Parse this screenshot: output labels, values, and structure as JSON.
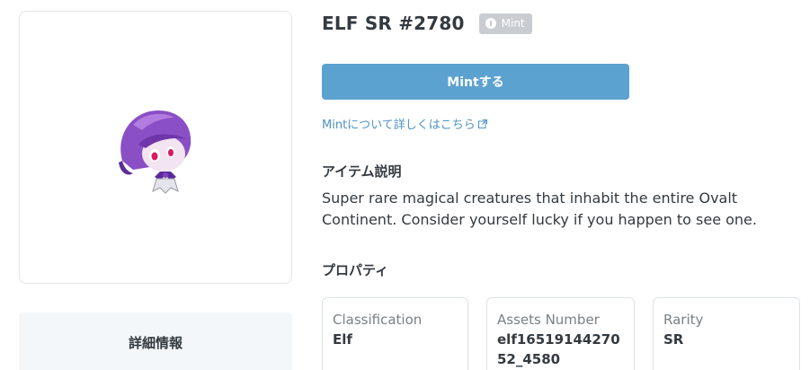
{
  "item": {
    "title": "ELF SR #2780",
    "badge": "Mint",
    "mint_button": "Mintする",
    "mint_link": "Mintについて詳しくはこちら"
  },
  "details": {
    "label": "詳細情報"
  },
  "description": {
    "heading": "アイテム説明",
    "text": "Super rare magical creatures that inhabit the entire Ovalt Continent. Consider yourself lucky if you happen to see one."
  },
  "properties": {
    "heading": "プロパティ",
    "items": [
      {
        "label": "Classification",
        "value": "Elf"
      },
      {
        "label": "Assets Number",
        "value": "elf1651914427052_4580"
      },
      {
        "label": "Rarity",
        "value": "SR"
      }
    ]
  },
  "colors": {
    "accent": "#5ba2d1",
    "link": "#4f93c4",
    "badge": "#c9cdd2"
  }
}
